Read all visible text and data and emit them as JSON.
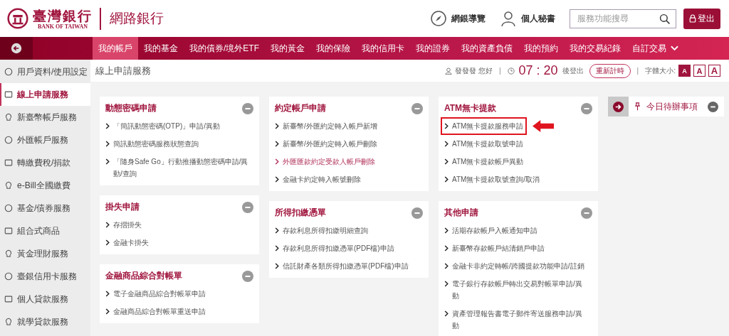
{
  "header": {
    "logo_name": "臺灣銀行",
    "logo_english": "BANK OF TAIWAN",
    "site_title": "網路銀行",
    "tools": [
      {
        "label": "網銀導覽"
      },
      {
        "label": "個人秘書"
      }
    ],
    "search": {
      "placeholder": "服務功能搜尋"
    },
    "logout": "登出"
  },
  "nav": {
    "items": [
      {
        "label": "我的帳戶",
        "selected": true
      },
      {
        "label": "我的基金",
        "selected": false
      },
      {
        "label": "我的債券/境外ETF",
        "selected": false
      },
      {
        "label": "我的黃金",
        "selected": false
      },
      {
        "label": "我的保險",
        "selected": false
      },
      {
        "label": "我的信用卡",
        "selected": false
      },
      {
        "label": "我的證券",
        "selected": false
      },
      {
        "label": "我的資產負債",
        "selected": false
      },
      {
        "label": "我的預約",
        "selected": false
      },
      {
        "label": "我的交易紀錄",
        "selected": false
      },
      {
        "label": "自訂交易",
        "selected": false
      }
    ]
  },
  "sidebar": {
    "items": [
      {
        "label": "用戶資料/使用設定",
        "selected": false
      },
      {
        "label": "線上申請服務",
        "selected": true
      },
      {
        "label": "新臺幣帳戶服務",
        "selected": false
      },
      {
        "label": "外匯帳戶服務",
        "selected": false
      },
      {
        "label": "轉繳費稅/捐款",
        "selected": false
      },
      {
        "label": "e-Bill全國繳費",
        "selected": false
      },
      {
        "label": "基金/債券服務",
        "selected": false
      },
      {
        "label": "組合式商品",
        "selected": false
      },
      {
        "label": "黃金理財服務",
        "selected": false
      },
      {
        "label": "臺銀信用卡服務",
        "selected": false
      },
      {
        "label": "個人貸款服務",
        "selected": false
      },
      {
        "label": "就學貸款服務",
        "selected": false
      }
    ]
  },
  "page_title": "線上申請服務",
  "session": {
    "greeting": "發發發 您好",
    "separator_1": "|",
    "countdown": "07 : 20",
    "countdown_suffix": "後登出",
    "reset_button": "重新計時",
    "separator_2": "|",
    "font_size_label": "字體大小:",
    "font_sizes": [
      {
        "label": "A",
        "selected": true
      },
      {
        "label": "A",
        "selected": false
      },
      {
        "label": "A",
        "selected": false
      }
    ]
  },
  "columns": [
    [
      {
        "title": "動態密碼申請",
        "items": [
          {
            "label": "「簡訊動態密碼(OTP)」申請/異動",
            "active": false,
            "marked": false
          },
          {
            "label": "簡訊動態密碼服務狀態查詢",
            "active": false,
            "marked": false
          },
          {
            "label": "「隨身Safe Go」行動推播動態密碼申請/異動/查詢",
            "active": false,
            "marked": false
          }
        ]
      },
      {
        "title": "掛失申請",
        "items": [
          {
            "label": "存摺掛失",
            "active": false,
            "marked": false
          },
          {
            "label": "金融卡掛失",
            "active": false,
            "marked": false
          }
        ]
      },
      {
        "title": "金融商品綜合對帳單",
        "items": [
          {
            "label": "電子金融商品綜合對帳單申請",
            "active": false,
            "marked": false
          },
          {
            "label": "金融商品綜合對帳單重送申請",
            "active": false,
            "marked": false
          }
        ]
      }
    ],
    [
      {
        "title": "約定帳戶申請",
        "items": [
          {
            "label": "新臺幣/外匯約定轉入帳戶新增",
            "active": false,
            "marked": false
          },
          {
            "label": "新臺幣/外匯約定轉入帳戶刪除",
            "active": false,
            "marked": false
          },
          {
            "label": "外匯匯款約定受款人帳戶刪除",
            "active": true,
            "marked": false
          },
          {
            "label": "金融卡約定轉入帳號刪除",
            "active": false,
            "marked": false
          }
        ]
      },
      {
        "title": "所得扣繳憑單",
        "items": [
          {
            "label": "存款利息所得扣繳明細查詢",
            "active": false,
            "marked": false
          },
          {
            "label": "存款利息所得扣繳憑單(PDF檔)申請",
            "active": false,
            "marked": false
          },
          {
            "label": "信託財產各類所得扣繳憑單(PDF檔)申請",
            "active": false,
            "marked": false
          }
        ]
      }
    ],
    [
      {
        "title": "ATM無卡提款",
        "items": [
          {
            "label": "ATM無卡提款服務申請",
            "active": false,
            "marked": true
          },
          {
            "label": "ATM無卡提款取號申請",
            "active": false,
            "marked": false
          },
          {
            "label": "ATM無卡提款帳戶異動",
            "active": false,
            "marked": false
          },
          {
            "label": "ATM無卡提款取號查詢/取消",
            "active": false,
            "marked": false
          }
        ]
      },
      {
        "title": "其他申請",
        "items": [
          {
            "label": "活期存款帳戶入帳通知申請",
            "active": false,
            "marked": false
          },
          {
            "label": "新臺幣存款帳戶結清銷戶申請",
            "active": false,
            "marked": false
          },
          {
            "label": "金融卡非約定轉帳/跨國提款功能申請/註銷",
            "active": false,
            "marked": false
          },
          {
            "label": "電子銀行存款帳戶轉出交易對帳單申請/異動",
            "active": false,
            "marked": false
          },
          {
            "label": "資產管理報告書電子郵件寄送服務申請/異動",
            "active": false,
            "marked": false
          }
        ]
      }
    ]
  ],
  "todo": {
    "title": "今日待辦事項"
  }
}
